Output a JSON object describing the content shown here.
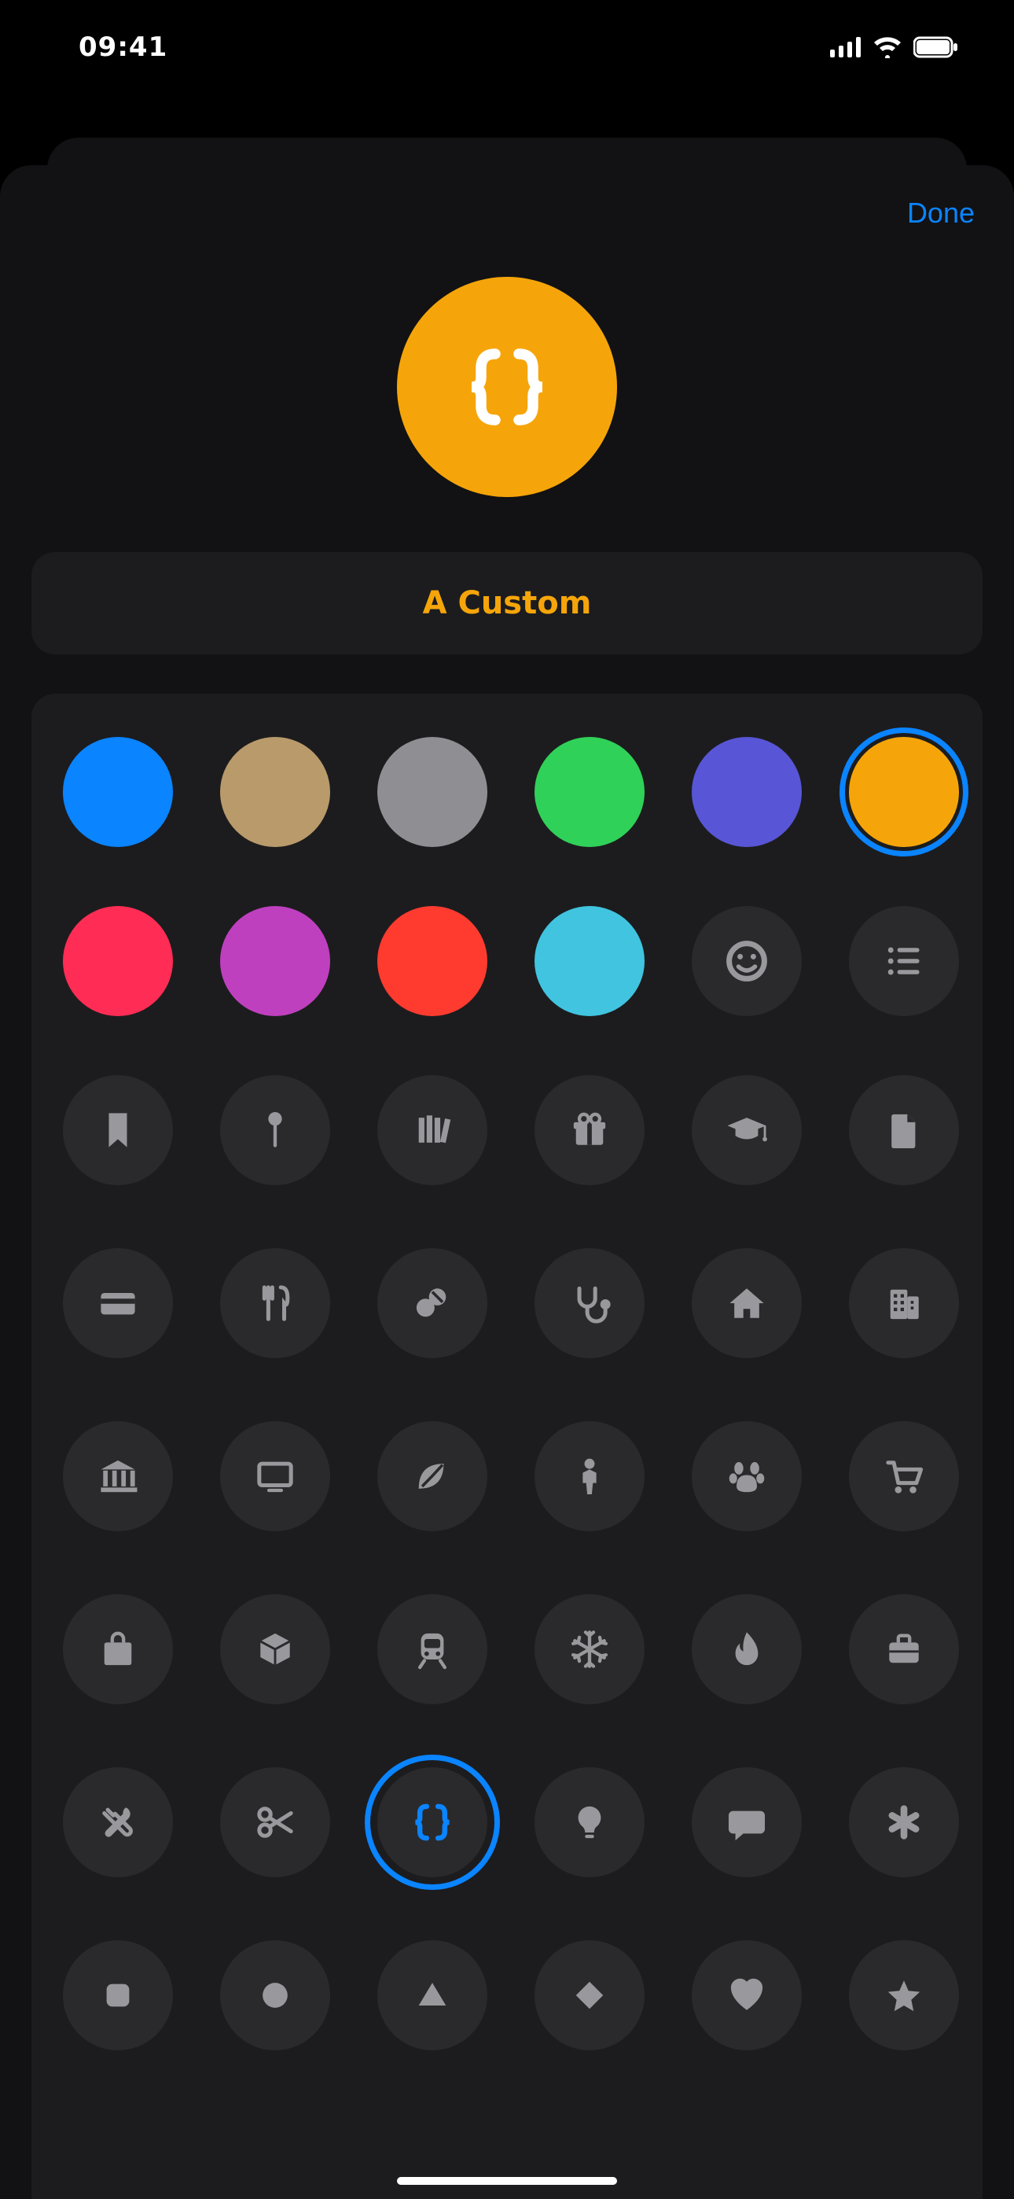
{
  "status": {
    "time": "09:41"
  },
  "sheet": {
    "done_label": "Done",
    "name": "A Custom",
    "accent": "#f5a50a",
    "selected_color_index": 5,
    "selected_icon": "code-braces",
    "colors": [
      "#0a84ff",
      "#b99a6b",
      "#8e8e93",
      "#30d158",
      "#5856d6",
      "#f5a50a",
      "#ff2d55",
      "#bf40bf",
      "#ff3b30",
      "#40c4e0"
    ],
    "action_icons": [
      "smiley",
      "more-list"
    ],
    "icons": [
      "bookmark",
      "pin",
      "books",
      "gift",
      "graduation-cap",
      "document",
      "credit-card",
      "utensils",
      "pills",
      "stethoscope",
      "house",
      "building",
      "bank",
      "monitor",
      "leaf",
      "person",
      "paw",
      "cart",
      "bag",
      "box",
      "train",
      "snowflake",
      "flame",
      "briefcase",
      "tools",
      "scissors",
      "code-braces",
      "lightbulb",
      "chat",
      "asterisk",
      "rounded-square",
      "circle",
      "triangle",
      "diamond",
      "heart",
      "star"
    ]
  }
}
